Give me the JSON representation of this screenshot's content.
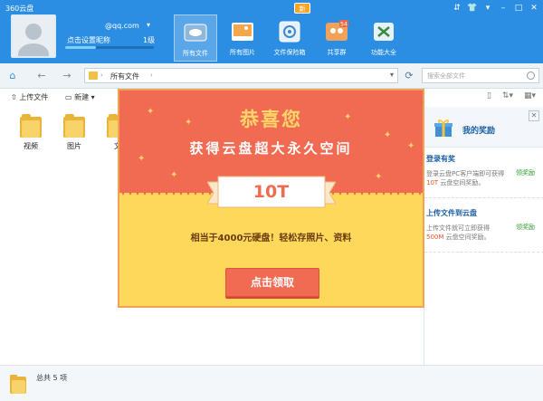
{
  "app": {
    "title": "360云盘"
  },
  "header": {
    "account": "@qq.com",
    "nickname": "点击设置昵称",
    "level": "1级",
    "level_progress": 0.35,
    "new_badge": "新",
    "tabs": [
      {
        "label": "所有文件",
        "icon": "all-files-icon"
      },
      {
        "label": "所有图片",
        "icon": "photos-icon"
      },
      {
        "label": "文件保险箱",
        "icon": "vault-icon"
      },
      {
        "label": "共享群",
        "icon": "share-group-icon"
      },
      {
        "label": "功能大全",
        "icon": "apps-icon"
      }
    ],
    "share_count": "54"
  },
  "addressbar": {
    "path": "所有文件",
    "search_placeholder": "搜索全部文件"
  },
  "toolbar": {
    "upload": "上传文件",
    "new": "新建"
  },
  "files": [
    {
      "name": "视频"
    },
    {
      "name": "图片"
    },
    {
      "name": "文"
    }
  ],
  "rewards": {
    "title": "我的奖励",
    "items": [
      {
        "title": "登录有奖",
        "desc_pre": "登录云盘PC客户端即可获得 ",
        "desc_hl": "10T",
        "desc_post": " 云盘空间奖励。",
        "action": "领奖励"
      },
      {
        "title": "上传文件到云盘",
        "desc_pre": "上传文件就可立即获得 ",
        "desc_hl": "500M",
        "desc_post": " 云盘空间奖励。",
        "action": "领奖励"
      }
    ]
  },
  "status": {
    "total": "总共 5 项"
  },
  "popup": {
    "title": "恭喜您",
    "subtitle": "获得云盘超大永久空间",
    "amount": "10T",
    "desc": "相当于4000元硬盘！轻松存照片、资料",
    "button": "点击领取"
  },
  "colors": {
    "header_blue": "#2b8ee3",
    "popup_red": "#f06b52",
    "popup_yellow": "#fdd85a",
    "title_gold": "#ffd56a"
  }
}
